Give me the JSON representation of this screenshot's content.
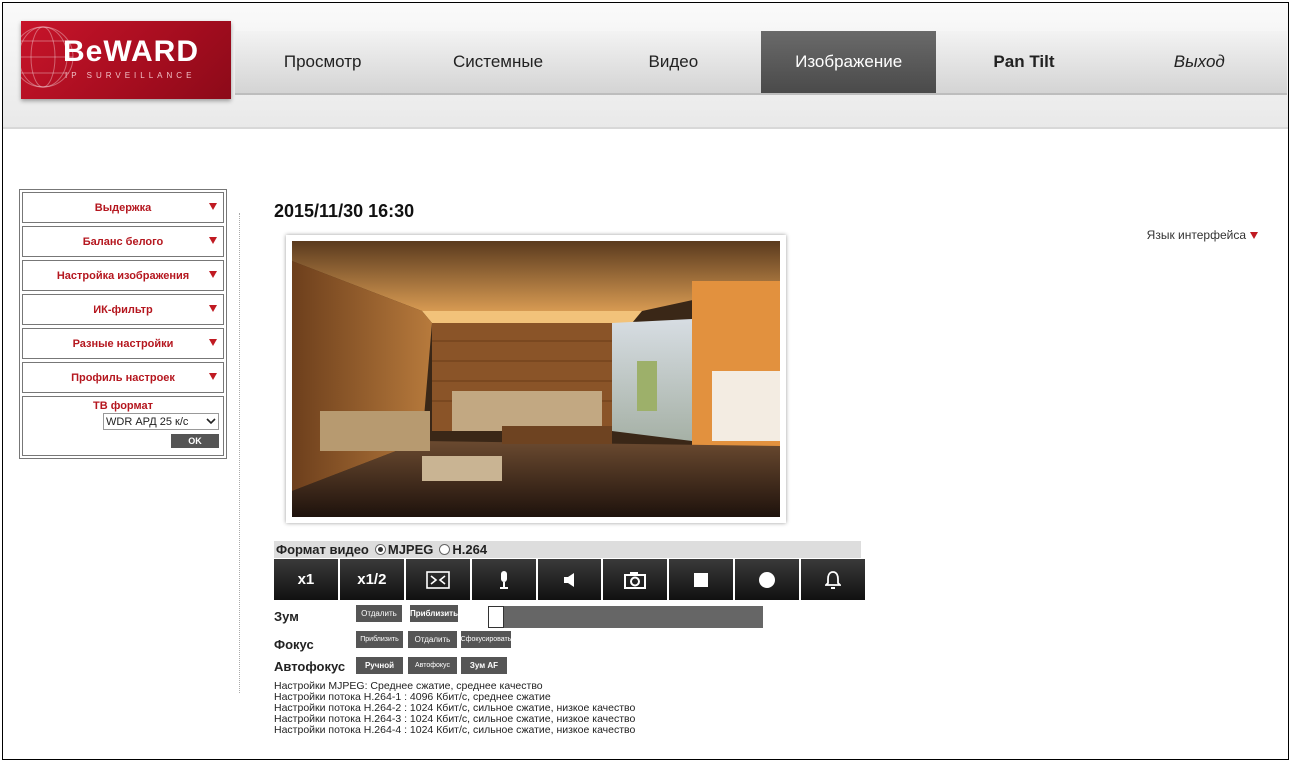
{
  "logo": {
    "brand": "BeWARD",
    "tagline": "IP SURVEILLANCE"
  },
  "nav": {
    "items": [
      "Просмотр",
      "Системные",
      "Видео",
      "Изображение",
      "Pan Tilt",
      "Выход"
    ],
    "active": "Изображение"
  },
  "sidebar": {
    "items": [
      "Выдержка",
      "Баланс белого",
      "Настройка изображения",
      "ИК-фильтр",
      "Разные настройки",
      "Профиль настроек"
    ],
    "tv_format_label": "ТВ формат",
    "tv_format_value": "WDR АРД 25 к/с",
    "ok_label": "OK"
  },
  "main": {
    "datetime": "2015/11/30 16:30",
    "language_label": "Язык интерфейса",
    "format_label": "Формат видео",
    "format_options": [
      "MJPEG",
      "H.264"
    ],
    "format_selected": "MJPEG",
    "toolbar": {
      "x1": "x1",
      "x_half": "x1/2"
    },
    "zoom": {
      "label": "Зум",
      "out": "Отдалить",
      "in": "Приблизить"
    },
    "focus": {
      "label": "Фокус",
      "near": "Приблизить",
      "far": "Отдалить",
      "auto": "Сфокусировать"
    },
    "autofocus": {
      "label": "Автофокус",
      "manual": "Ручной",
      "auto": "Автофокус",
      "zoom_af": "Зум AF"
    },
    "info_lines": [
      "Настройки MJPEG: Среднее сжатие, среднее качество",
      "Настройки потока H.264-1 : 4096 Кбит/с, среднее сжатие",
      "Настройки потока H.264-2 : 1024 Кбит/с, сильное сжатие, низкое качество",
      "Настройки потока H.264-3 : 1024 Кбит/с, сильное сжатие, низкое качество",
      "Настройки потока H.264-4 : 1024 Кбит/с, сильное сжатие, низкое качество"
    ]
  },
  "colors": {
    "accent": "#c01a22",
    "active_tab": "#555555",
    "toolbar": "#1a1a1a"
  }
}
